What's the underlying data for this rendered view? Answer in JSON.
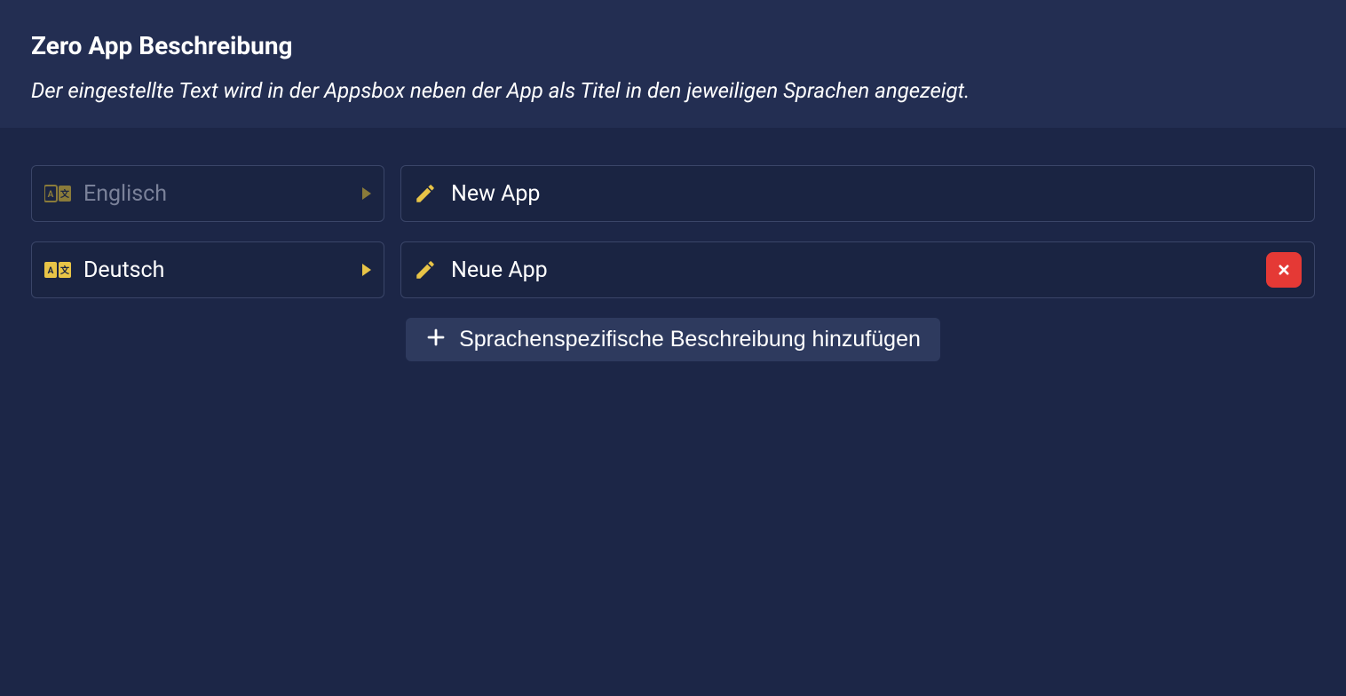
{
  "header": {
    "title": "Zero App Beschreibung",
    "description": "Der eingestellte Text wird in der Appsbox neben der App als Titel in den jeweiligen Sprachen angezeigt."
  },
  "rows": [
    {
      "language": "Englisch",
      "value": "New App",
      "deletable": false,
      "active": false
    },
    {
      "language": "Deutsch",
      "value": "Neue App",
      "deletable": true,
      "active": true
    }
  ],
  "addButton": {
    "label": "Sprachenspezifische Beschreibung hinzufügen"
  },
  "colors": {
    "accent": "#e8c447",
    "danger": "#e53935",
    "bgHeader": "#232e52",
    "bgBody": "#1c2647",
    "bgField": "#1a2442",
    "border": "#3a4568"
  }
}
